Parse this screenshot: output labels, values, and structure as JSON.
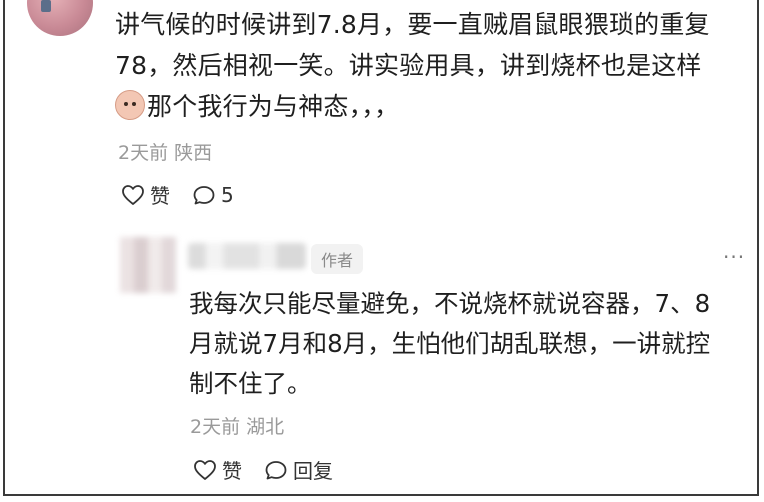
{
  "top_comment": {
    "text_line1": "讲气候的时候讲到7.8月，要一直贼眉鼠眼猥琐的重复",
    "text_line2": "78，然后相视一笑。讲实验用具，讲到烧杯也是这样",
    "text_line3": "那个我行为与神态，，，",
    "emoji_icon": "baby-face-emoji-icon",
    "meta": "2天前 陕西",
    "like_label": "赞",
    "reply_count": "5"
  },
  "reply": {
    "author_badge": "作者",
    "more_glyph": "···",
    "text_line1": "我每次只能尽量避免，不说烧杯就说容器，7、8",
    "text_line2": "月就说7月和8月，生怕他们胡乱联想，一讲就控",
    "text_line3": "制不住了。",
    "meta": "2天前 湖北",
    "like_label": "赞",
    "reply_label": "回复"
  },
  "colors": {
    "text": "#1f1f1f",
    "meta": "#9a9a9a",
    "badge_bg": "#f2f2f2",
    "frame": "#3a3a3a"
  }
}
